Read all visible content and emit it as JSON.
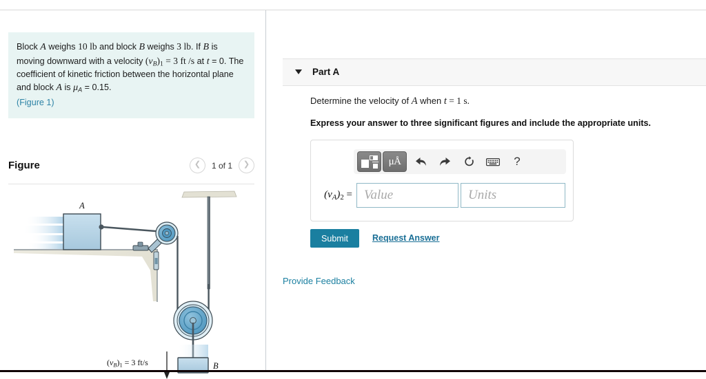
{
  "problem": {
    "line1_a": "Block ",
    "var_A": "A",
    "line1_b": " weighs ",
    "w_A": "10",
    "unit_lb1": "lb",
    "line1_c": " and block ",
    "var_B": "B",
    "line1_d": " weighs ",
    "w_B": "3",
    "unit_lb2": "lb",
    "line1_e": ". If ",
    "var_B2": "B",
    "line1_f": " is moving downward with a velocity ",
    "vB_v": "v",
    "vB_sub": "B",
    "vB_idx": "1",
    "eq1": " = ",
    "vB_val": "3",
    "vB_unit": "ft /s",
    "at_t": " at ",
    "var_t": "t",
    "eq2": " = 0. The coefficient of kinetic friction between the horizontal plane and block ",
    "var_A2": "A",
    "is_mu": " is ",
    "mu": "μ",
    "mu_sub": "A",
    "mu_eq": " = 0.15.",
    "figure_link": "(Figure 1)"
  },
  "figure": {
    "title": "Figure",
    "prev_icon": "chevron-left-icon",
    "next_icon": "chevron-right-icon",
    "counter": "1 of 1",
    "labels": {
      "block_a": "A",
      "block_b": "B",
      "velocity_v": "v",
      "velocity_sub": "B",
      "velocity_idx": "1",
      "velocity_eq": " = 3 ft/s"
    },
    "colors": {
      "block_fill_top": "#c3dcec",
      "block_fill_bottom": "#a8c9de",
      "pulley_outer": "#d7e9f2",
      "pulley_inner": "#5da2c8",
      "ground": "#e9e7dc",
      "outline": "#3d4a52",
      "motion_blur": "#bcd9ec"
    }
  },
  "part": {
    "caret_icon": "chevron-down-icon",
    "label": "Part A",
    "question_a": "Determine the velocity of ",
    "question_var": "A",
    "question_b": " when ",
    "question_t": "t",
    "question_c": " = 1 s.",
    "instruction": "Express your answer to three significant figures and include the appropriate units."
  },
  "answer": {
    "toolbar": [
      {
        "name": "math-template-button",
        "label": ""
      },
      {
        "name": "units-button",
        "label": "μÅ"
      },
      {
        "name": "undo-button",
        "label": "↰"
      },
      {
        "name": "redo-button",
        "label": "↱"
      },
      {
        "name": "reset-button",
        "label": "↺"
      },
      {
        "name": "keyboard-button",
        "label": "⌨"
      },
      {
        "name": "help-button",
        "label": "?"
      }
    ],
    "label_v": "v",
    "label_sub": "A",
    "label_idx": "2",
    "label_eq": " =",
    "value_placeholder": "Value",
    "value": "",
    "units_placeholder": "Units",
    "units": "",
    "submit_label": "Submit",
    "request_answer_label": "Request Answer"
  },
  "footer": {
    "provide_feedback_label": "Provide Feedback"
  },
  "theme": {
    "accent": "#1a7fa0",
    "link": "#1a6f96",
    "problem_bg": "#e8f4f3",
    "panel_bg": "#f7f7f7"
  }
}
